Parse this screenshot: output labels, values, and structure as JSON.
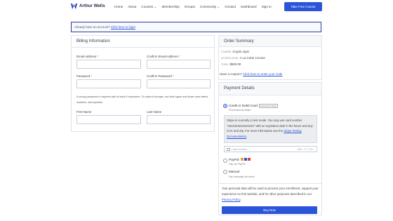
{
  "brand": {
    "name": "Arthur Wells",
    "accent": "#2b55d9",
    "logo_icon": "w-logo-icon"
  },
  "nav": {
    "items": [
      "Home",
      "About",
      "Courses ⌄",
      "Membership",
      "Groups",
      "Community ⌄",
      "Contact",
      "Dashboard",
      "Sign In"
    ],
    "cta": "Take Free Course"
  },
  "notice": {
    "text": "Already have an account? ",
    "link": "Click here to login"
  },
  "billing": {
    "title": "Billing Information",
    "email_label": "Email Address",
    "confirm_email_label": "Confirm Email Address",
    "password_label": "Password",
    "confirm_password_label": "Confirm Password",
    "required_mark": "*",
    "hint": "A strong password is required with at least 8 characters. To make it stronger, use both upper and lower case letters, numbers, and symbols",
    "first_name_label": "First Name",
    "last_name_label": "Last Name"
  },
  "summary": {
    "title": "Order Summary",
    "course_key": "Course:",
    "course_val": "Crypto Apps",
    "access_key": "Access Level:",
    "access_val": "A La Carte Course",
    "total_key": "Total:",
    "total_val": "$500.00",
    "coupon_text": "Have a coupon? ",
    "coupon_link": "Click here to enter your code"
  },
  "payment": {
    "title": "Payment Details",
    "card_label": "Credit or Debit Card",
    "card_chip": "Powered by Stripe",
    "card_sub": "Processed by Stripe",
    "stripe_text": "Stripe is currently in test mode. You may use card number \"4242424242424242\" with an expiration date in the future and any CVC and Zip. For more information see the ",
    "stripe_link": "Stripe Testing Documentation",
    "stripe_end": ".",
    "card_placeholder": "Card number",
    "card_right": "MM / YY  CVC",
    "paypal_label": "PayPal",
    "paypal_sub": "Pay via PayPal",
    "manual_label": "Manual",
    "manual_sub": "Pay manually via check",
    "privacy_text": "Your personal data will be used to process your enrollment, support your experience on this website, and for other purposes described in our ",
    "privacy_link": "Privacy Policy",
    "privacy_end": ".",
    "buy_label": "Buy Now"
  }
}
